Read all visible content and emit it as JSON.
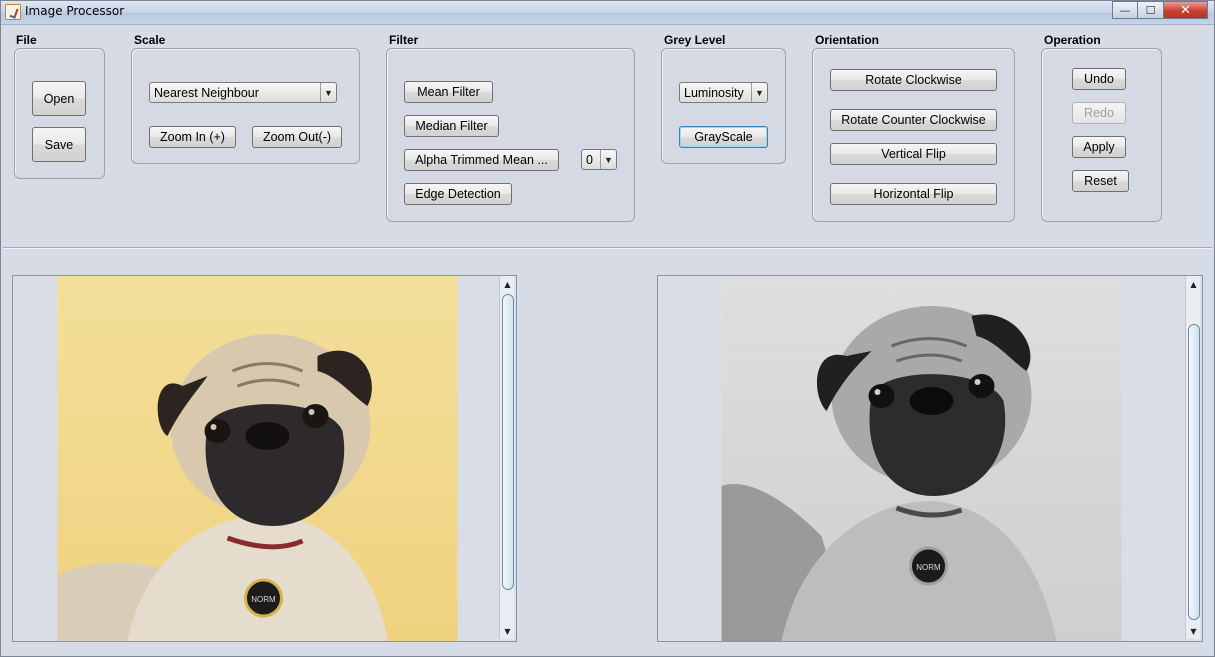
{
  "window": {
    "title": "Image Processor",
    "minimize_glyph": "—",
    "maximize_glyph": "☐",
    "close_glyph": "✕"
  },
  "groups": {
    "file": {
      "title": "File",
      "open_label": "Open",
      "save_label": "Save"
    },
    "scale": {
      "title": "Scale",
      "method_selected": "Nearest Neighbour",
      "zoom_in_label": "Zoom In (+)",
      "zoom_out_label": "Zoom Out(-)"
    },
    "filter": {
      "title": "Filter",
      "mean_label": "Mean Filter",
      "median_label": "Median Filter",
      "alpha_label": "Alpha Trimmed Mean ...",
      "alpha_value": "0",
      "edge_label": "Edge Detection"
    },
    "grey": {
      "title": "Grey Level",
      "method_selected": "Luminosity",
      "grayscale_label": "GrayScale"
    },
    "orientation": {
      "title": "Orientation",
      "rotate_cw_label": "Rotate Clockwise",
      "rotate_ccw_label": "Rotate Counter Clockwise",
      "vflip_label": "Vertical Flip",
      "hflip_label": "Horizontal Flip"
    },
    "operation": {
      "title": "Operation",
      "undo_label": "Undo",
      "redo_label": "Redo",
      "apply_label": "Apply",
      "reset_label": "Reset"
    }
  },
  "images": {
    "original_tag": "NORM",
    "processed_tag": "NORM"
  },
  "colors": {
    "original_background": "#f1d98a",
    "processed_background": "#d4d4d4",
    "focus_border": "#3c7fb1"
  }
}
